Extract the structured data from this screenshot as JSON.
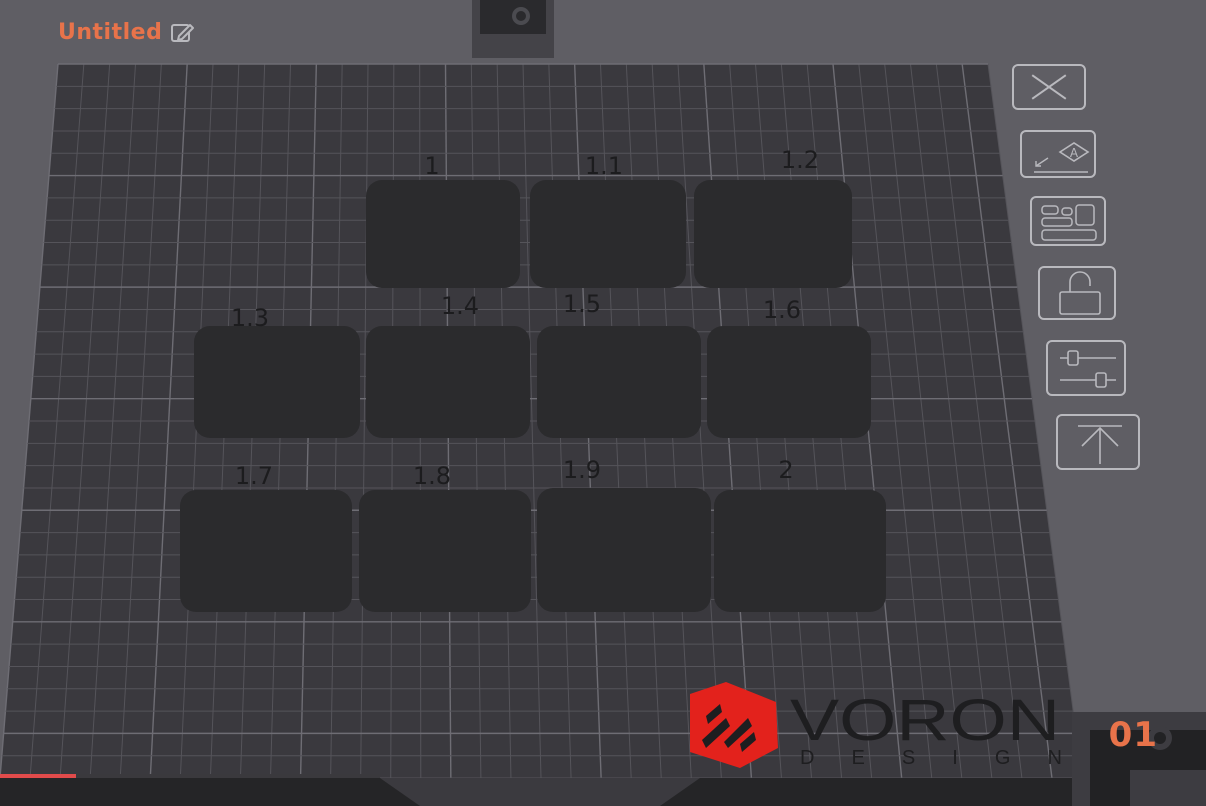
{
  "project": {
    "title": "Untitled",
    "edit_icon": "pencil-square-icon"
  },
  "plate": {
    "number": "01",
    "parts": [
      {
        "label": "1"
      },
      {
        "label": "1.1"
      },
      {
        "label": "1.2"
      },
      {
        "label": "1.3"
      },
      {
        "label": "1.4"
      },
      {
        "label": "1.5"
      },
      {
        "label": "1.6"
      },
      {
        "label": "1.7"
      },
      {
        "label": "1.8"
      },
      {
        "label": "1.9"
      },
      {
        "label": "2"
      }
    ]
  },
  "toolbar": [
    {
      "name": "close-icon",
      "action": "close"
    },
    {
      "name": "auto-orient-icon",
      "action": "auto-orient"
    },
    {
      "name": "arrange-icon",
      "action": "arrange"
    },
    {
      "name": "unlock-icon",
      "action": "lock"
    },
    {
      "name": "settings-sliders-icon",
      "action": "plate-settings"
    },
    {
      "name": "upload-icon",
      "action": "slice"
    }
  ],
  "logo": {
    "word": "VORON",
    "sub": "DESIGN"
  },
  "progress": {
    "fraction": 0.2
  },
  "colors": {
    "accent": "#e8734a",
    "logo_red": "#e3221c",
    "bed": "#3a393e",
    "part": "#2b2b2d"
  }
}
